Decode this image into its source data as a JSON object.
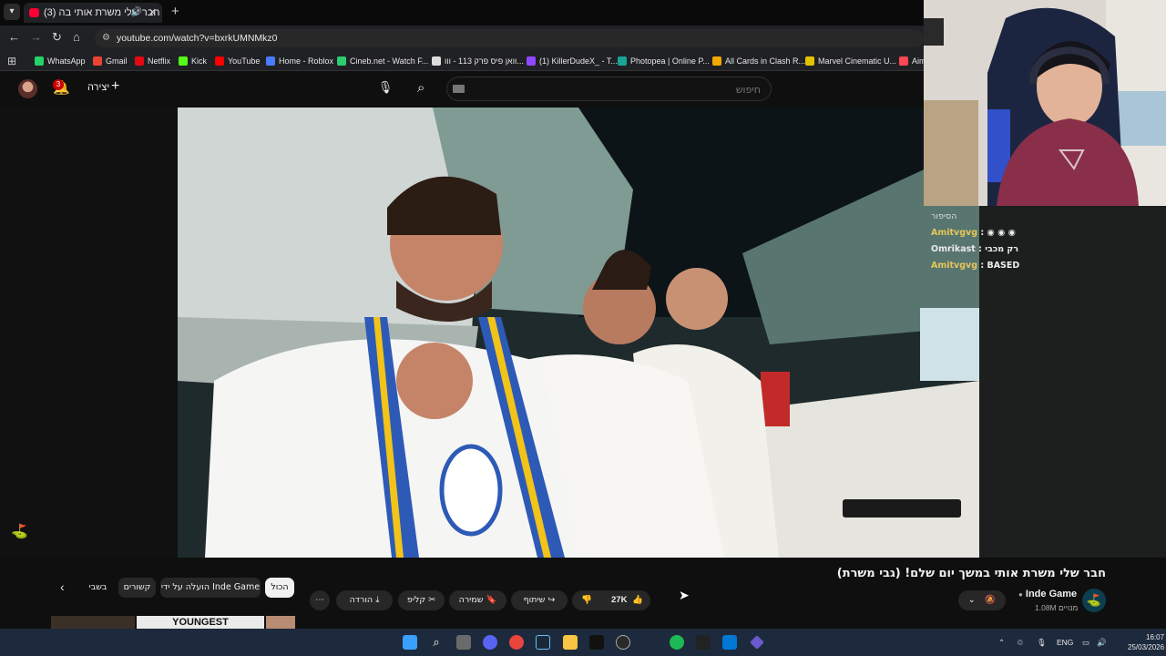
{
  "browser": {
    "tab_title": "(3) חבר שלי משרת אותי בה",
    "url": "youtube.com/watch?v=bxrkUMNMkz0",
    "bookmarks": [
      {
        "label": "WhatsApp",
        "color": "#25d366"
      },
      {
        "label": "Gmail",
        "color": "#ea4335"
      },
      {
        "label": "Netflix",
        "color": "#e50914"
      },
      {
        "label": "Kick",
        "color": "#53fc18"
      },
      {
        "label": "YouTube",
        "color": "#ff0000"
      },
      {
        "label": "Home - Roblox",
        "color": "#4a7cff"
      },
      {
        "label": "Cineb.net - Watch F...",
        "color": "#2ecc71"
      },
      {
        "label": "וואן פיס פרק 113 - ווו...",
        "color": "#dddddd"
      },
      {
        "label": "(1) KillerDudeX_ - T...",
        "color": "#9147ff"
      },
      {
        "label": "Photopea | Online P...",
        "color": "#18a497"
      },
      {
        "label": "All Cards in Clash R...",
        "color": "#f2a900"
      },
      {
        "label": "Marvel Cinematic U...",
        "color": "#e5c200"
      },
      {
        "label": "Aim",
        "color": "#ff4655"
      }
    ]
  },
  "youtube": {
    "create_label": "יצירה",
    "notification_count": "3",
    "search_placeholder": "חיפוש"
  },
  "chat": {
    "header": "הסיפור",
    "messages": [
      {
        "user": "Amitvgvg",
        "text": ""
      },
      {
        "user": "Omrikast",
        "text": "רק מכבי"
      },
      {
        "user": "Amitvgvg",
        "text": "BASED"
      }
    ]
  },
  "video": {
    "title": "חבר שלי משרת אותי במשך יום שלם! (גבי משרת)",
    "channel_name": "Inde Game",
    "subscribers": "1.08M מנויים",
    "likes": "27K",
    "actions": {
      "share": "שיתוף",
      "save": "שמירה",
      "clip": "קליפ",
      "download": "הורדה"
    }
  },
  "chips": {
    "all": "הכול",
    "uploaded_by": "הועלה על ידי Inde Game",
    "related": "קשורים",
    "partial": "בשבי"
  },
  "next_thumb_text": "YOUNGEST",
  "taskbar": {
    "lang": "ENG",
    "time": "16:07",
    "date": "25/03/2026"
  }
}
